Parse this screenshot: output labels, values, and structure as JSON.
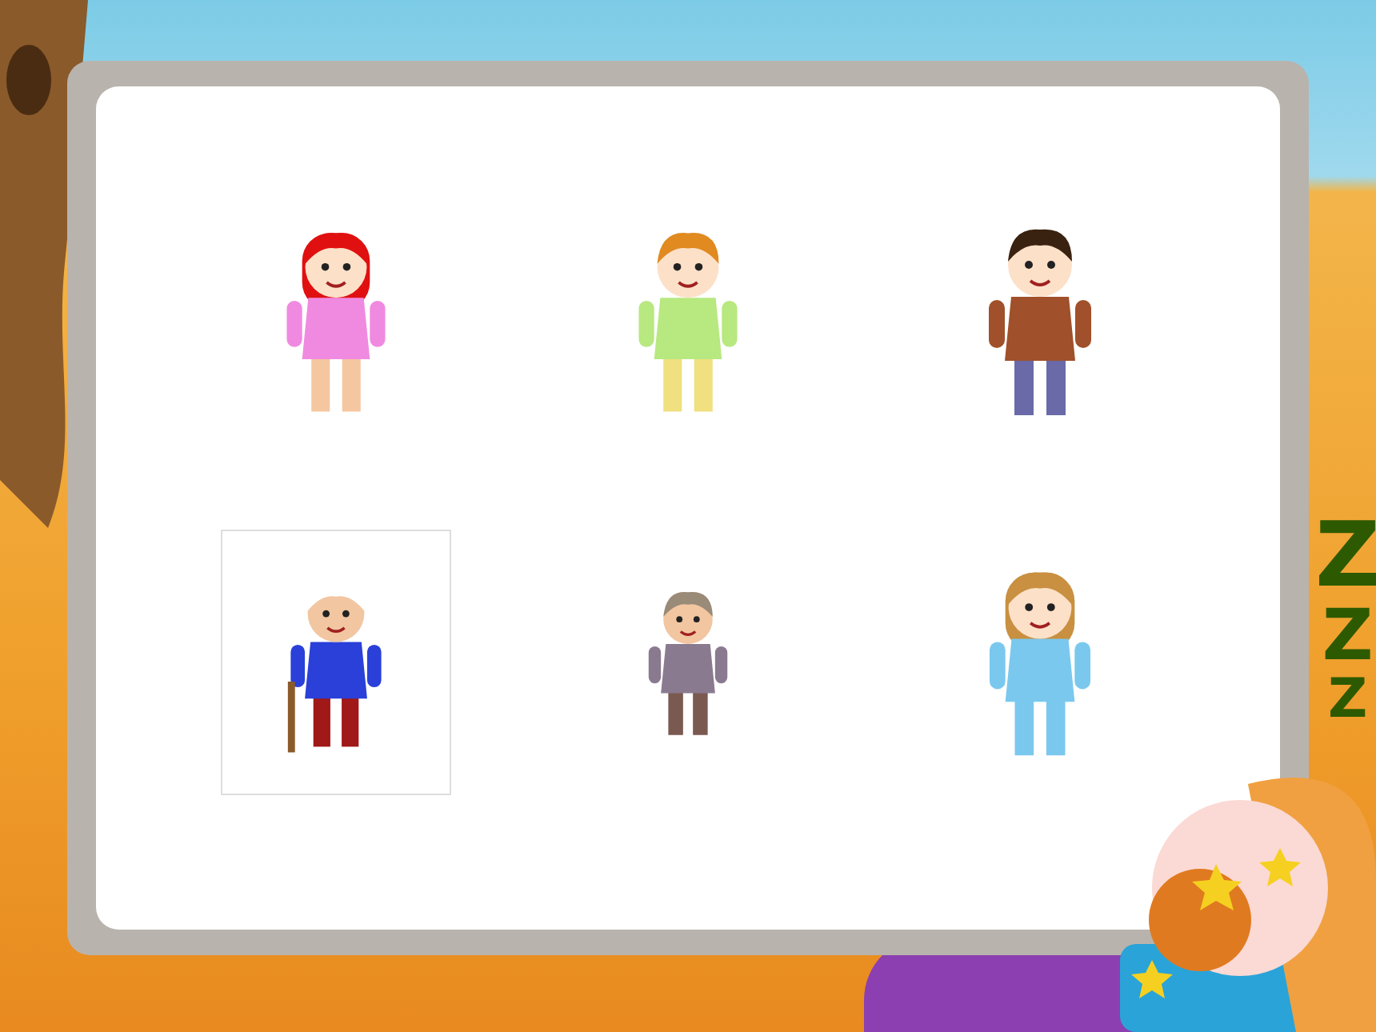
{
  "slide": {
    "figures": [
      {
        "kind": "girl",
        "framed": false
      },
      {
        "kind": "boy",
        "framed": false
      },
      {
        "kind": "man",
        "framed": false
      },
      {
        "kind": "old-man",
        "framed": true
      },
      {
        "kind": "old-woman",
        "framed": false
      },
      {
        "kind": "woman",
        "framed": false
      }
    ],
    "sleep_marks": [
      "Z",
      "Z",
      "Z"
    ]
  }
}
